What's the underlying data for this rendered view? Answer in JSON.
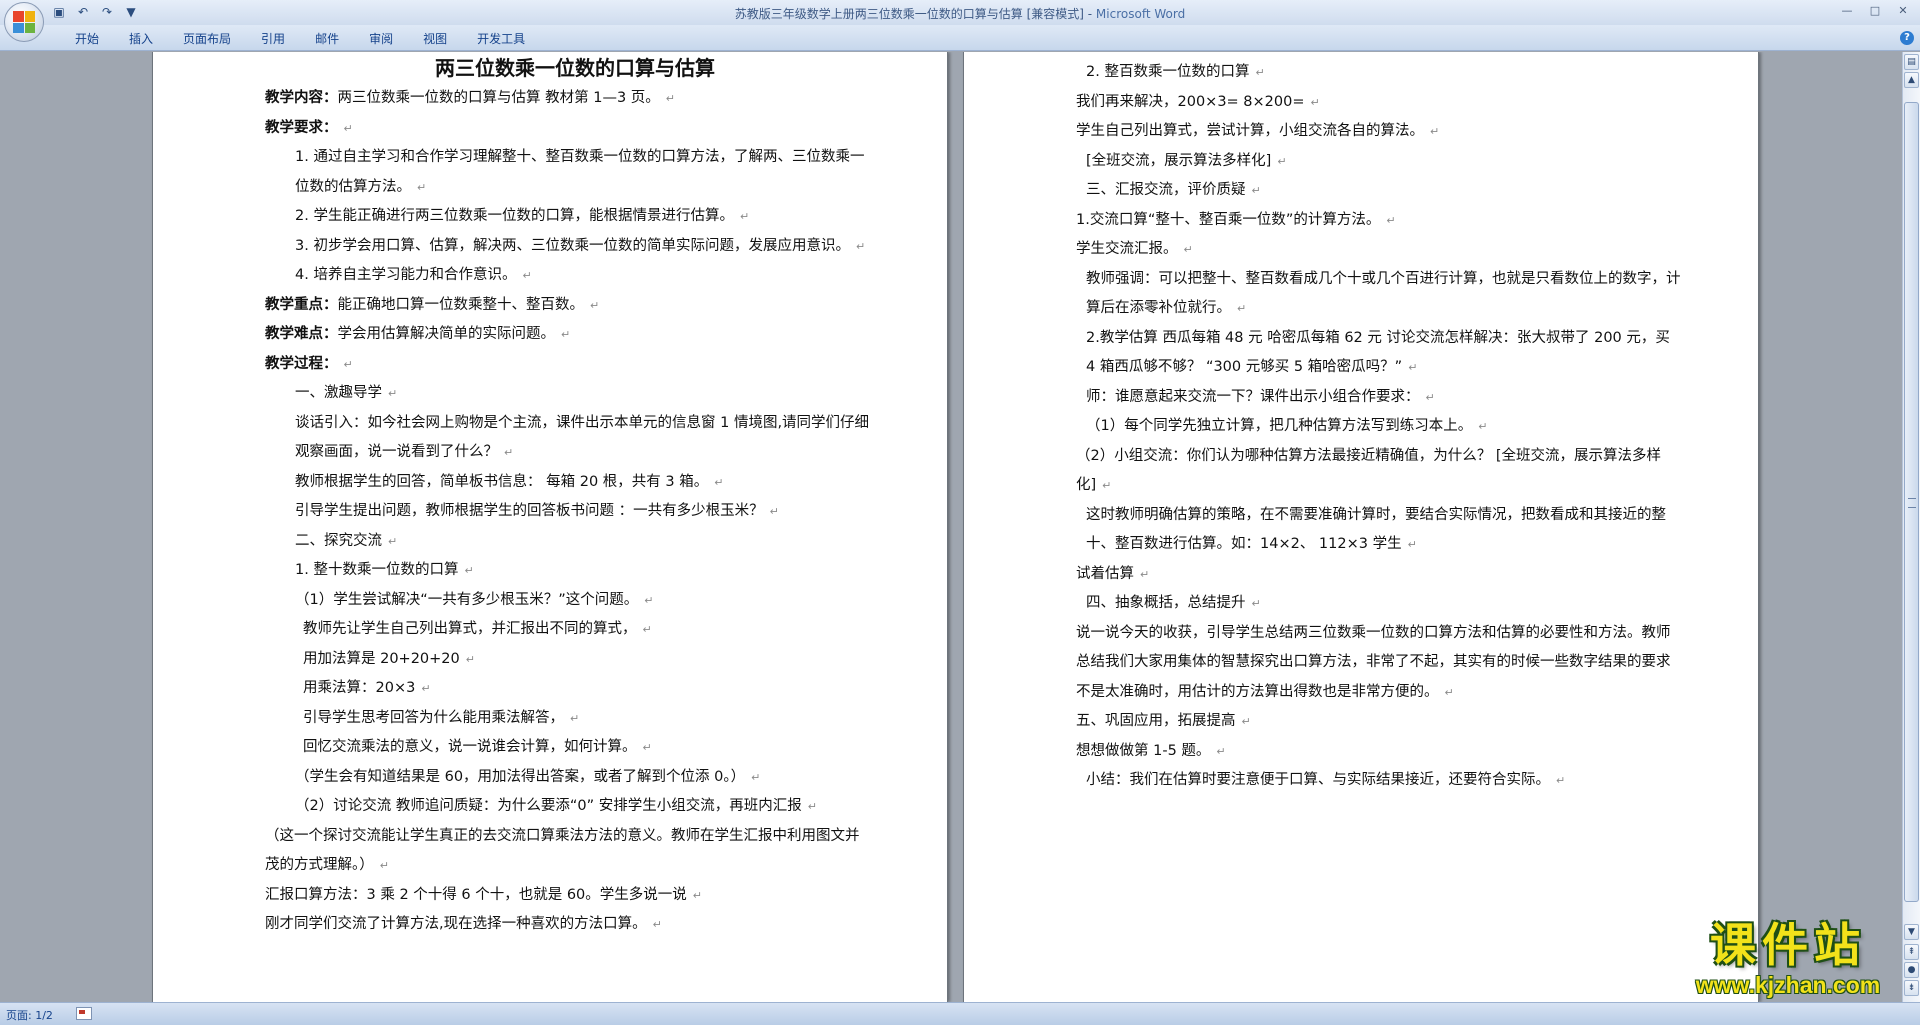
{
  "window": {
    "title": "苏教版三年级数学上册两三位数乘一位数的口算与估算 [兼容模式] - Microsoft Word",
    "title_doc": "苏教版三年级数学上册两三位数乘一位数的口算与估算 [兼容模式] - ",
    "title_app": "Microsoft Word",
    "controls": [
      "—",
      "□",
      "✕"
    ]
  },
  "quick_access": {
    "save": "save-icon",
    "undo": "undo-icon",
    "redo": "redo-icon",
    "customize": "▼"
  },
  "ribbon": {
    "tabs": [
      "开始",
      "插入",
      "页面布局",
      "引用",
      "邮件",
      "审阅",
      "视图",
      "开发工具"
    ],
    "help": "?"
  },
  "document": {
    "page1": {
      "title": "两三位数乘一位数的口算与估算",
      "paragraphs": [
        {
          "label": "教学内容：",
          "text": "两三位数乘一位数的口算与估算 教材第 1—3 页。"
        },
        {
          "label": "教学要求：",
          "text": ""
        },
        {
          "text": "1. 通过自主学习和合作学习理解整十、整百数乘一位数的口算方法，了解两、三位数乘一位数的估算方法。"
        },
        {
          "text": "2. 学生能正确进行两三位数乘一位数的口算，能根据情景进行估算。"
        },
        {
          "text": "3. 初步学会用口算、估算，解决两、三位数乘一位数的简单实际问题，发展应用意识。"
        },
        {
          "text": "4. 培养自主学习能力和合作意识。"
        },
        {
          "label": "教学重点：",
          "text": "能正确地口算一位数乘整十、整百数。"
        },
        {
          "label": "教学难点：",
          "text": "学会用估算解决简单的实际问题。"
        },
        {
          "label": "教学过程：",
          "text": ""
        },
        {
          "text": "一、激趣导学"
        },
        {
          "text": "谈话引入：如今社会网上购物是个主流，课件出示本单元的信息窗 1 情境图,请同学们仔细观察画面，说一说看到了什么？"
        },
        {
          "text": "教师根据学生的回答，简单板书信息： 每箱 20 根，共有 3 箱。"
        },
        {
          "text": "引导学生提出问题，教师根据学生的回答板书问题 ：一共有多少根玉米？"
        },
        {
          "text": "二、探究交流"
        },
        {
          "text": "1. 整十数乘一位数的口算"
        },
        {
          "text": "（1）学生尝试解决“一共有多少根玉米？”这个问题。"
        },
        {
          "text": "教师先让学生自己列出算式，并汇报出不同的算式，"
        },
        {
          "text": "用加法算是 20+20+20"
        },
        {
          "text": "用乘法算：20×3"
        },
        {
          "text": "引导学生思考回答为什么能用乘法解答，"
        },
        {
          "text": "回忆交流乘法的意义，说一说谁会计算，如何计算。"
        },
        {
          "text": "（学生会有知道结果是 60，用加法得出答案，或者了解到个位添 0。）"
        },
        {
          "text": "（2）讨论交流 教师追问质疑：为什么要添“0” 安排学生小组交流，再班内汇报"
        },
        {
          "text": "（这一个探讨交流能让学生真正的去交流口算乘法方法的意义。教师在学生汇报中利用图文并茂的方式理解。）"
        },
        {
          "text": "汇报口算方法：3 乘 2 个十得 6 个十，也就是 60。学生多说一说"
        },
        {
          "text": "刚才同学们交流了计算方法,现在选择一种喜欢的方法口算。"
        }
      ]
    },
    "page2": {
      "paragraphs": [
        {
          "text": "2. 整百数乘一位数的口算"
        },
        {
          "text": "我们再来解决，200×3=        8×200="
        },
        {
          "text": "学生自己列出算式，尝试计算，小组交流各自的算法。"
        },
        {
          "text": "[全班交流，展示算法多样化]"
        },
        {
          "text": "三、汇报交流，评价质疑"
        },
        {
          "text": "1.交流口算“整十、整百乘一位数”的计算方法。"
        },
        {
          "text": "学生交流汇报。"
        },
        {
          "text": "教师强调：可以把整十、整百数看成几个十或几个百进行计算，也就是只看数位上的数字，计算后在添零补位就行。"
        },
        {
          "text": "2.教学估算 西瓜每箱 48 元 哈密瓜每箱 62 元  讨论交流怎样解决：张大叔带了 200 元，买 4 箱西瓜够不够？ “300 元够买 5 箱哈密瓜吗？”"
        },
        {
          "text": "师：谁愿意起来交流一下？课件出示小组合作要求："
        },
        {
          "text": "（1）每个同学先独立计算，把几种估算方法写到练习本上。"
        },
        {
          "text": "（2）小组交流：你们认为哪种估算方法最接近精确值，为什么？ [全班交流，展示算法多样化]"
        },
        {
          "text": "这时教师明确估算的策略，在不需要准确计算时，要结合实际情况，把数看成和其接近的整十、整百数进行估算。如：14×2、 112×3 学生"
        },
        {
          "text": "试着估算"
        },
        {
          "text": "四、抽象概括，总结提升"
        },
        {
          "text": "说一说今天的收获，引导学生总结两三位数乘一位数的口算方法和估算的必要性和方法。教师总结我们大家用集体的智慧探究出口算方法，非常了不起，其实有的时候一些数字结果的要求不是太准确时，用估计的方法算出得数也是非常方便的。"
        },
        {
          "text": "五、巩固应用，拓展提高"
        },
        {
          "text": "想想做做第 1-5 题。"
        },
        {
          "text": "小结：我们在估算时要注意便于口算、与实际结果接近，还要符合实际。"
        }
      ]
    }
  },
  "statusbar": {
    "page_info": "页面: 1/2"
  },
  "watermark": {
    "main": "课件站",
    "url": "www.kjzhan.com"
  },
  "colors": {
    "ribbon_text": "#15428b",
    "page_bg": "#ffffff",
    "workspace_bg": "#9fa6b0",
    "watermark_fill": "#f2e21a"
  }
}
